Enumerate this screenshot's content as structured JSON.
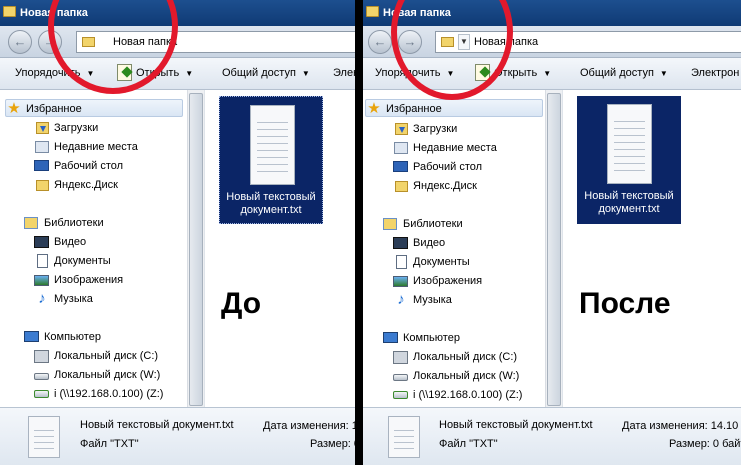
{
  "left": {
    "window_title": "Новая папка",
    "address_path": "Новая папка",
    "toolbar": {
      "organize": "Упорядочить",
      "open": "Открыть",
      "share": "Общий доступ",
      "burn_cut": "Элек"
    },
    "nav": {
      "favorites": "Избранное",
      "downloads": "Загрузки",
      "recent": "Недавние места",
      "desktop": "Рабочий стол",
      "yandex": "Яндекс.Диск",
      "libraries": "Библиотеки",
      "video": "Видео",
      "documents": "Документы",
      "images": "Изображения",
      "music": "Музыка",
      "computer": "Компьютер",
      "drive_c": "Локальный диск (C:)",
      "drive_w": "Локальный диск (W:)",
      "drive_z": "i (\\\\192.168.0.100) (Z:)"
    },
    "file_name": "Новый текстовый документ.txt",
    "caption": "До",
    "details": {
      "name": "Новый текстовый документ.txt",
      "type": "Файл \"TXT\"",
      "modified_label": "Дата изменения: 1",
      "size_label": "Размер: 0"
    }
  },
  "right": {
    "window_title": "Новая папка",
    "address_path": "Новая папка",
    "toolbar": {
      "organize": "Упорядочить",
      "open": "Открыть",
      "share": "Общий доступ",
      "burn_cut": "Электрон"
    },
    "nav": {
      "favorites": "Избранное",
      "downloads": "Загрузки",
      "recent": "Недавние места",
      "desktop": "Рабочий стол",
      "yandex": "Яндекс.Диск",
      "libraries": "Библиотеки",
      "video": "Видео",
      "documents": "Документы",
      "images": "Изображения",
      "music": "Музыка",
      "computer": "Компьютер",
      "drive_c": "Локальный диск (C:)",
      "drive_w": "Локальный диск (W:)",
      "drive_z": "i (\\\\192.168.0.100) (Z:)"
    },
    "file_name": "Новый текстовый документ.txt",
    "caption": "После",
    "details": {
      "name": "Новый текстовый документ.txt",
      "type": "Файл \"TXT\"",
      "modified_label": "Дата изменения: 14.10",
      "size_label": "Размер: 0 байт"
    }
  },
  "icons": {
    "back": "back-arrow-icon",
    "forward": "forward-arrow-icon",
    "star": "star-icon",
    "folder": "folder-icon"
  },
  "colors": {
    "title_bar": "#1d4f8f",
    "selection": "#0b2566",
    "annotation_circle": "#e2192c",
    "divider": "#000000"
  }
}
